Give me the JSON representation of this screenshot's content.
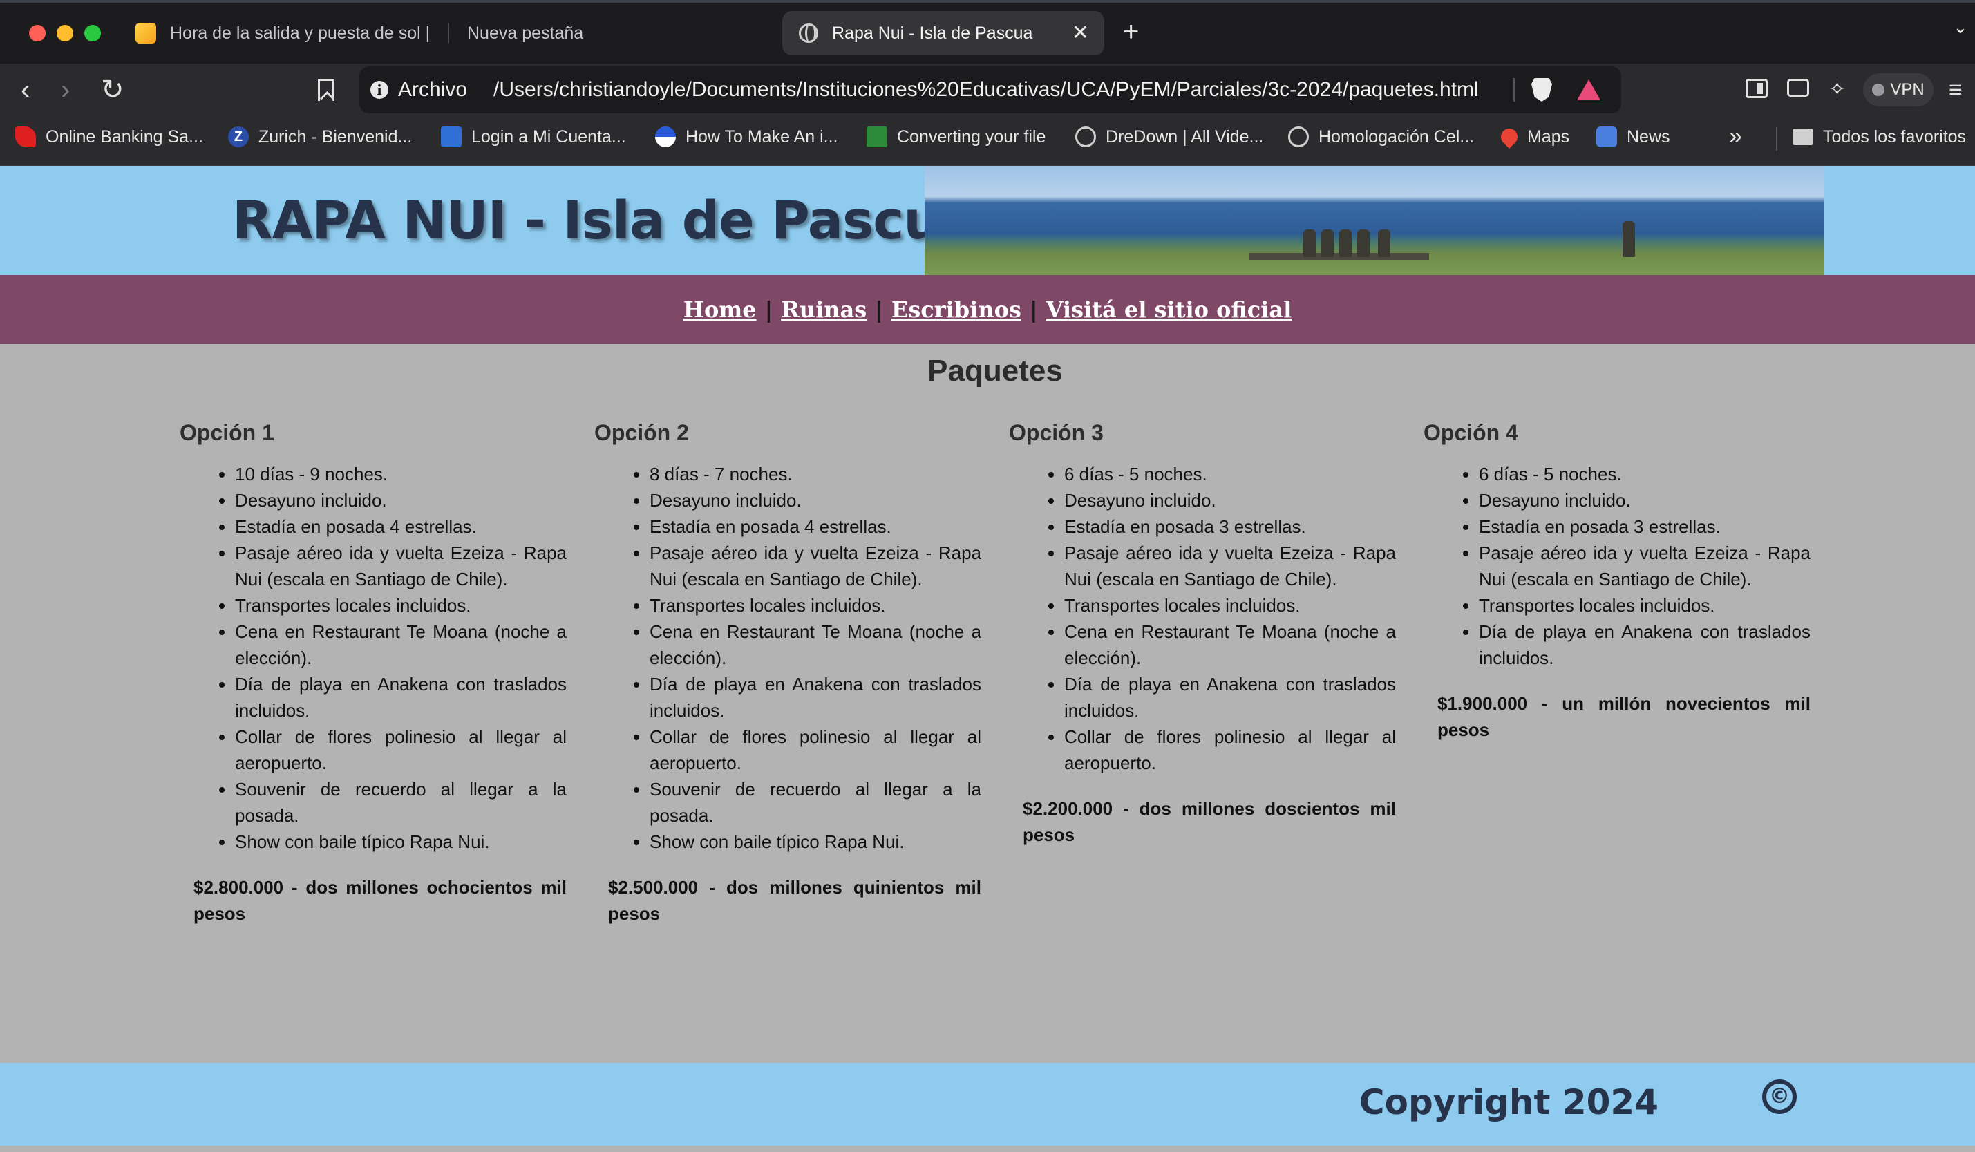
{
  "browser": {
    "tabs": [
      {
        "label": "Hora de la salida y puesta de sol |"
      },
      {
        "label": "Nueva pestaña"
      },
      {
        "label": "Rapa Nui - Isla de Pascua"
      }
    ],
    "address": {
      "scheme": "Archivo",
      "path": "/Users/christiandoyle/Documents/Instituciones%20Educativas/UCA/PyEM/Parciales/3c-2024/paquetes.html"
    },
    "vpn_label": "VPN",
    "bookmarks": [
      "Online Banking Sa...",
      "Zurich - Bienvenid...",
      "Login a Mi Cuenta...",
      "How To Make An i...",
      "Converting your file",
      "DreDown | All Vide...",
      "Homologación Cel...",
      "Maps",
      "News"
    ],
    "bookmarks_all": "Todos los favoritos"
  },
  "site": {
    "title": "RAPA NUI - Isla de Pascua",
    "nav": [
      "Home",
      "Ruinas",
      "Escribinos",
      "Visitá el sitio oficial"
    ],
    "page_title": "Paquetes",
    "options": [
      {
        "title": "Opción 1",
        "items": [
          "10 días - 9 noches.",
          "Desayuno incluido.",
          "Estadía en posada 4 estrellas.",
          "Pasaje aéreo ida y vuelta Ezeiza - Rapa Nui (escala en Santiago de Chile).",
          "Transportes locales incluidos.",
          "Cena en Restaurant Te Moana (noche a elección).",
          "Día de playa en Anakena con traslados incluidos.",
          "Collar de flores polinesio al llegar al aeropuerto.",
          "Souvenir de recuerdo al llegar a la posada.",
          "Show con baile típico Rapa Nui."
        ],
        "price": "$2.800.000 - dos millones ochocientos mil pesos"
      },
      {
        "title": "Opción 2",
        "items": [
          "8 días - 7 noches.",
          "Desayuno incluido.",
          "Estadía en posada 4 estrellas.",
          "Pasaje aéreo ida y vuelta Ezeiza - Rapa Nui (escala en Santiago de Chile).",
          "Transportes locales incluidos.",
          "Cena en Restaurant Te Moana (noche a elección).",
          "Día de playa en Anakena con traslados incluidos.",
          "Collar de flores polinesio al llegar al aeropuerto.",
          "Souvenir de recuerdo al llegar a la posada.",
          "Show con baile típico Rapa Nui."
        ],
        "price": "$2.500.000 - dos millones quinientos mil pesos"
      },
      {
        "title": "Opción 3",
        "items": [
          "6 días - 5 noches.",
          "Desayuno incluido.",
          "Estadía en posada 3 estrellas.",
          "Pasaje aéreo ida y vuelta Ezeiza - Rapa Nui (escala en Santiago de Chile).",
          "Transportes locales incluidos.",
          "Cena en Restaurant Te Moana (noche a elección).",
          "Día de playa en Anakena con traslados incluidos.",
          "Collar de flores polinesio al llegar al aeropuerto."
        ],
        "price": "$2.200.000 - dos millones doscientos mil pesos"
      },
      {
        "title": "Opción 4",
        "items": [
          "6 días - 5 noches.",
          "Desayuno incluido.",
          "Estadía en posada 3 estrellas.",
          "Pasaje aéreo ida y vuelta Ezeiza - Rapa Nui (escala en Santiago de Chile).",
          "Transportes locales incluidos.",
          "Día de playa en Anakena con traslados incluidos."
        ],
        "price": "$1.900.000 - un millón novecientos mil pesos"
      }
    ],
    "footer": "Copyright 2024",
    "footer_symbol": "©"
  },
  "colors": {
    "header_bg": "#8ecbee",
    "nav_bg": "#7e4866",
    "page_bg": "#b3b3b3",
    "title_color": "#26334a"
  }
}
